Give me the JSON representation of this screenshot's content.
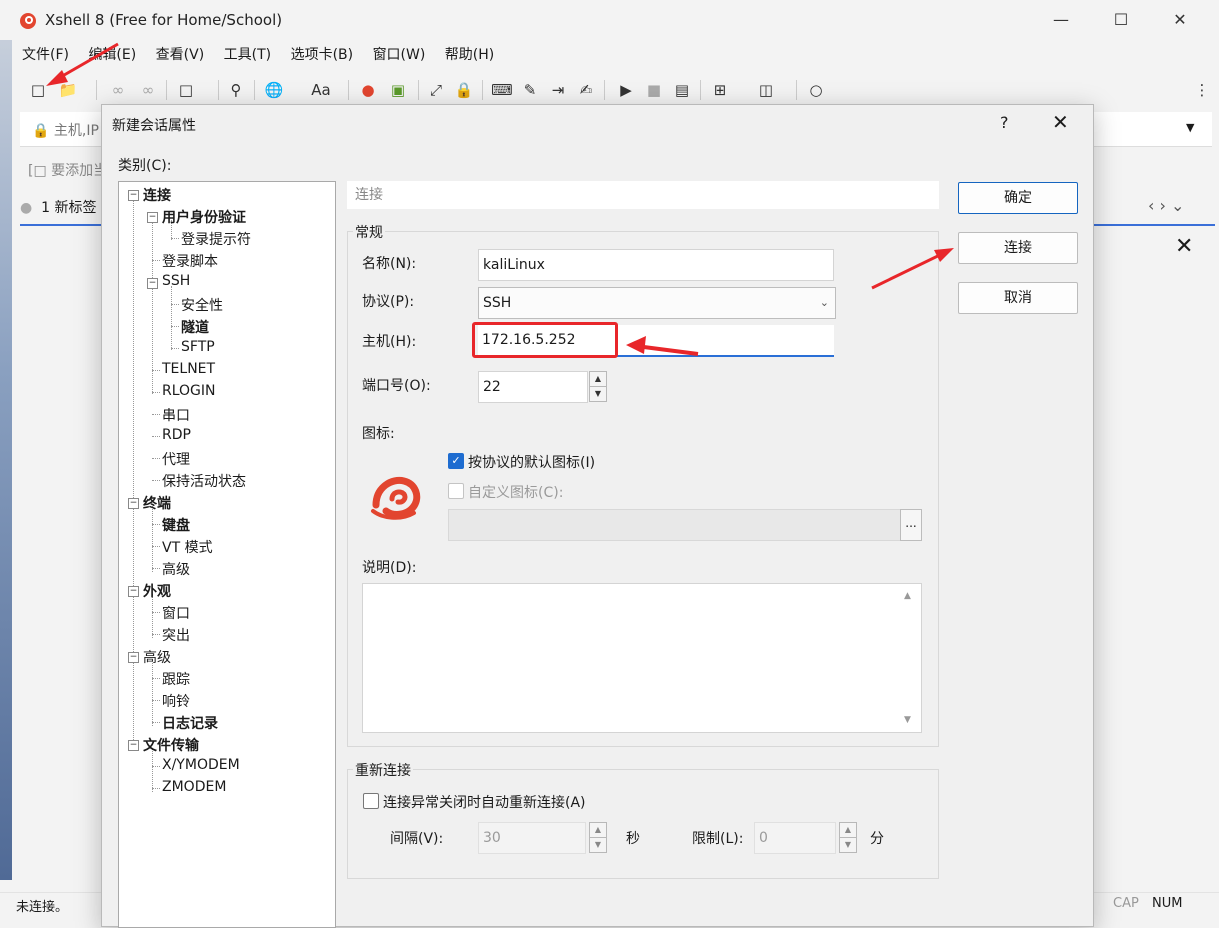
{
  "app": {
    "title": "Xshell 8 (Free for Home/School)",
    "menu": [
      "文件(F)",
      "编辑(E)",
      "查看(V)",
      "工具(T)",
      "选项卡(B)",
      "窗口(W)",
      "帮助(H)"
    ],
    "address_placeholder": "主机,IP",
    "hint": "要添加当",
    "tab": "1 新标签",
    "status_left": "未连接。",
    "status_caps": "CAP",
    "status_num": "NUM"
  },
  "dialog": {
    "title": "新建会话属性",
    "help": "?",
    "category_label": "类别(C):",
    "breadcrumb": "连接",
    "tree": [
      {
        "label": "连接",
        "bold": true
      },
      {
        "label": "用户身份验证",
        "bold": true
      },
      {
        "label": "登录提示符",
        "bold": false
      },
      {
        "label": "登录脚本",
        "bold": false
      },
      {
        "label": "SSH",
        "bold": false
      },
      {
        "label": "安全性",
        "bold": false
      },
      {
        "label": "隧道",
        "bold": true
      },
      {
        "label": "SFTP",
        "bold": false
      },
      {
        "label": "TELNET",
        "bold": false
      },
      {
        "label": "RLOGIN",
        "bold": false
      },
      {
        "label": "串口",
        "bold": false
      },
      {
        "label": "RDP",
        "bold": false
      },
      {
        "label": "代理",
        "bold": false
      },
      {
        "label": "保持活动状态",
        "bold": false
      },
      {
        "label": "终端",
        "bold": true
      },
      {
        "label": "键盘",
        "bold": true
      },
      {
        "label": "VT 模式",
        "bold": false
      },
      {
        "label": "高级",
        "bold": false
      },
      {
        "label": "外观",
        "bold": true
      },
      {
        "label": "窗口",
        "bold": false
      },
      {
        "label": "突出",
        "bold": false
      },
      {
        "label": "高级",
        "bold": false
      },
      {
        "label": "跟踪",
        "bold": false
      },
      {
        "label": "响铃",
        "bold": false
      },
      {
        "label": "日志记录",
        "bold": true
      },
      {
        "label": "文件传输",
        "bold": true
      },
      {
        "label": "X/YMODEM",
        "bold": false
      },
      {
        "label": "ZMODEM",
        "bold": false
      }
    ],
    "general": {
      "title": "常规",
      "name_label": "名称(N):",
      "name_value": "kaliLinux",
      "protocol_label": "协议(P):",
      "protocol_value": "SSH",
      "host_label": "主机(H):",
      "host_value": "172.16.5.252",
      "port_label": "端口号(O):",
      "port_value": "22",
      "icon_label": "图标:",
      "default_icon_label": "按协议的默认图标(I)",
      "custom_icon_label": "自定义图标(C):",
      "browse": "...",
      "desc_label": "说明(D):"
    },
    "reconnect": {
      "title": "重新连接",
      "auto_label": "连接异常关闭时自动重新连接(A)",
      "interval_label": "间隔(V):",
      "interval_value": "30",
      "interval_unit": "秒",
      "limit_label": "限制(L):",
      "limit_value": "0",
      "limit_unit": "分"
    },
    "buttons": {
      "ok": "确定",
      "connect": "连接",
      "cancel": "取消"
    }
  },
  "colors": {
    "accent": "#1e6cd0",
    "annotation": "#e8262a",
    "logo": "#e2452f"
  }
}
